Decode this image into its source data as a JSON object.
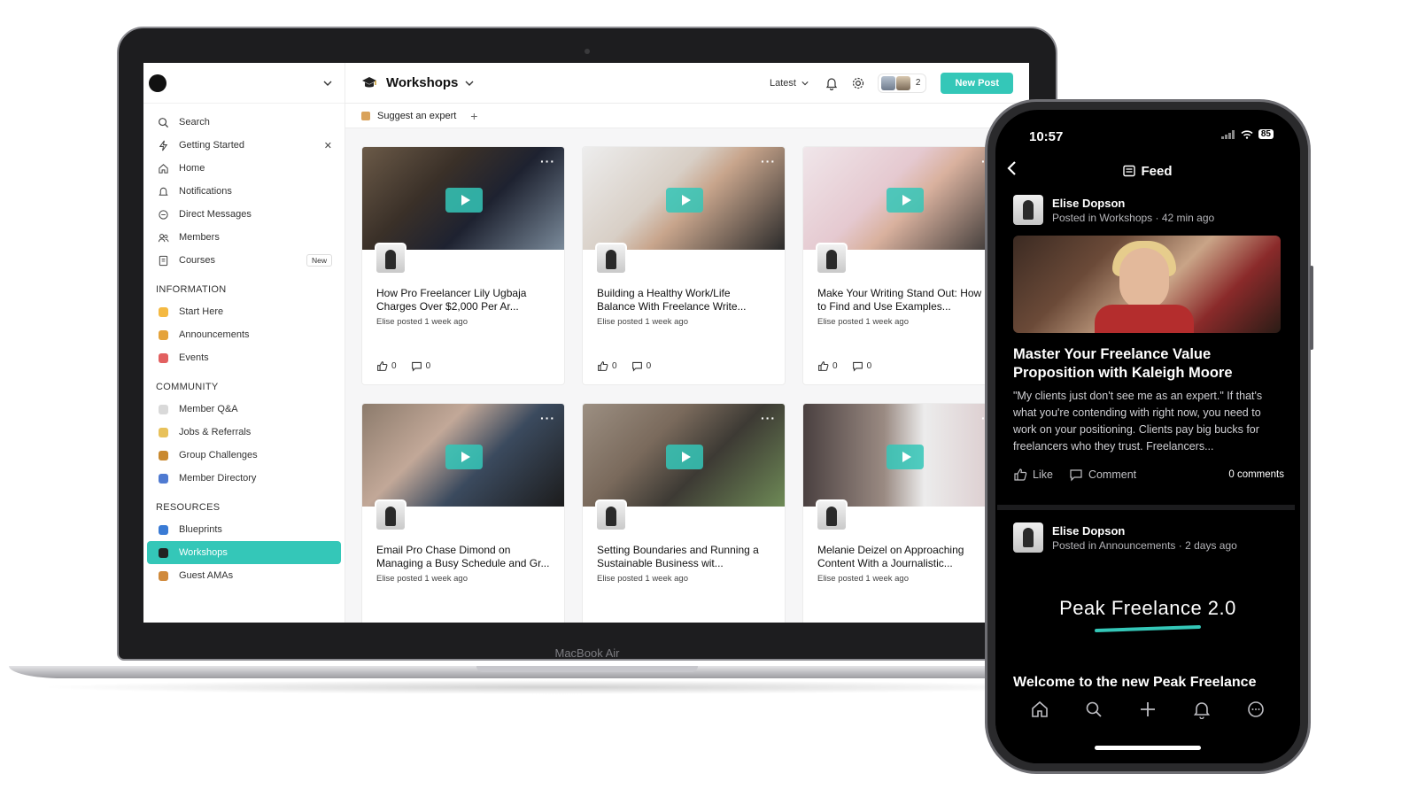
{
  "laptop": {
    "model_label": "MacBook Air",
    "sidebar": {
      "items": [
        {
          "label": "Search",
          "icon": "search-icon"
        },
        {
          "label": "Getting Started",
          "icon": "bolt-icon",
          "closable": true
        },
        {
          "label": "Home",
          "icon": "home-icon"
        },
        {
          "label": "Notifications",
          "icon": "bell-icon"
        },
        {
          "label": "Direct Messages",
          "icon": "chat-icon"
        },
        {
          "label": "Members",
          "icon": "members-icon"
        },
        {
          "label": "Courses",
          "icon": "book-icon",
          "badge": "New"
        }
      ],
      "sections": [
        {
          "title": "INFORMATION",
          "items": [
            {
              "label": "Start Here",
              "color": "#f4b942"
            },
            {
              "label": "Announcements",
              "color": "#e5a33b"
            },
            {
              "label": "Events",
              "color": "#e26060"
            }
          ]
        },
        {
          "title": "COMMUNITY",
          "items": [
            {
              "label": "Member Q&A",
              "color": "#d9d9d9"
            },
            {
              "label": "Jobs & Referrals",
              "color": "#e8c15a"
            },
            {
              "label": "Group Challenges",
              "color": "#c9892f"
            },
            {
              "label": "Member Directory",
              "color": "#4f7ad1"
            }
          ]
        },
        {
          "title": "RESOURCES",
          "items": [
            {
              "label": "Blueprints",
              "color": "#3a7bd5",
              "active": false
            },
            {
              "label": "Workshops",
              "color": "#222222",
              "active": true
            },
            {
              "label": "Guest AMAs",
              "color": "#d08a3c",
              "active": false
            }
          ]
        }
      ]
    },
    "topbar": {
      "title": "Workshops",
      "sort": "Latest",
      "member_count": "2",
      "new_post": "New Post"
    },
    "subbar": {
      "link": "Suggest an expert"
    },
    "cards": [
      {
        "title": "How Pro Freelancer Lily Ugbaja Charges Over $2,000 Per Ar...",
        "meta": "Elise posted 1 week ago",
        "likes": "0",
        "comments": "0",
        "thumb": "linear-gradient(135deg,#6b5a48 0%,#3a3028 35%,#1e2230 60%,#7a8a9a 100%)"
      },
      {
        "title": "Building a Healthy Work/Life Balance With Freelance Write...",
        "meta": "Elise posted 1 week ago",
        "likes": "0",
        "comments": "0",
        "thumb": "linear-gradient(135deg,#ededed 0%,#d8cfc6 40%,#c8a58c 55%,#2a2a2a 100%)"
      },
      {
        "title": "Make Your Writing Stand Out: How to Find and Use Examples...",
        "meta": "Elise posted 1 week ago",
        "likes": "0",
        "comments": "0",
        "thumb": "linear-gradient(135deg,#f0e6ea 0%,#e5c9d0 40%,#d9b19e 55%,#2d2d2d 100%)"
      },
      {
        "title": "Email Pro Chase Dimond on Managing a Busy Schedule and Gr...",
        "meta": "Elise posted 1 week ago",
        "likes": "",
        "comments": "",
        "thumb": "linear-gradient(135deg,#8c7b6c 0%,#c2a898 35%,#3b4a5e 60%,#1c1c1c 100%)"
      },
      {
        "title": "Setting Boundaries and Running a Sustainable Business wit...",
        "meta": "Elise posted 1 week ago",
        "likes": "",
        "comments": "",
        "thumb": "linear-gradient(135deg,#9c8f82 0%,#7a6a5c 35%,#3d3a34 60%,#6e8a56 100%)"
      },
      {
        "title": "Melanie Deizel on Approaching Content With a Journalistic...",
        "meta": "Elise posted 1 week ago",
        "likes": "",
        "comments": "",
        "thumb": "linear-gradient(90deg,#4a4040 0%,#9a8a82 40%,#ececec 60%,#d9c7c9 100%)"
      }
    ]
  },
  "phone": {
    "time": "10:57",
    "battery": "85",
    "header": "Feed",
    "post1": {
      "author": "Elise Dopson",
      "sub": "Posted in Workshops · 42 min ago",
      "title": "Master Your Freelance Value Proposition with Kaleigh Moore",
      "text": "\"My clients just don't see me as an expert.\" If that's what you're contending with right now, you need to work on your positioning. Clients pay big bucks for freelancers who they trust. Freelancers...",
      "like": "Like",
      "comment": "Comment",
      "count": "0 comments"
    },
    "post2": {
      "author": "Elise Dopson",
      "sub": "Posted in Announcements · 2 days ago",
      "brand": "Peak Freelance 2.0",
      "welcome": "Welcome to the new Peak Freelance"
    }
  },
  "colors": {
    "accent": "#34c7b8",
    "phone_bg": "#000000"
  }
}
